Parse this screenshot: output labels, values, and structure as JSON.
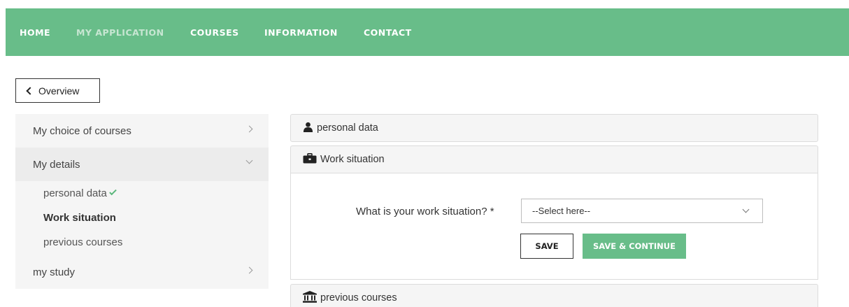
{
  "nav": {
    "items": [
      {
        "label": "HOME"
      },
      {
        "label": "MY APPLICATION"
      },
      {
        "label": "COURSES"
      },
      {
        "label": "INFORMATION"
      },
      {
        "label": "CONTACT"
      }
    ],
    "background_color": "#68bd89"
  },
  "overview_button": {
    "label": "Overview",
    "icon": "chevron-left-icon"
  },
  "sidebar": {
    "items": [
      {
        "label": "My choice of courses",
        "icon": "chevron-right-icon"
      },
      {
        "label": "My details",
        "icon": "chevron-down-icon"
      },
      {
        "label": "my study",
        "icon": "chevron-right-icon"
      }
    ],
    "sub_items": [
      {
        "label": "personal data",
        "icon": "check-icon",
        "completed": true
      },
      {
        "label": "Work situation",
        "active": true
      },
      {
        "label": "previous courses"
      }
    ]
  },
  "panels": {
    "personal": {
      "title": "personal data",
      "icon": "user-icon"
    },
    "work": {
      "title": "Work situation",
      "icon": "briefcase-icon"
    },
    "previous": {
      "title": "previous courses",
      "icon": "institution-icon"
    }
  },
  "form": {
    "question": "What is your work situation? *",
    "select_value": "--Select here--",
    "save_label": "SAVE",
    "save_continue_label": "SAVE & CONTINUE"
  },
  "colors": {
    "accent": "#68bd89",
    "check": "#5bb77c"
  }
}
